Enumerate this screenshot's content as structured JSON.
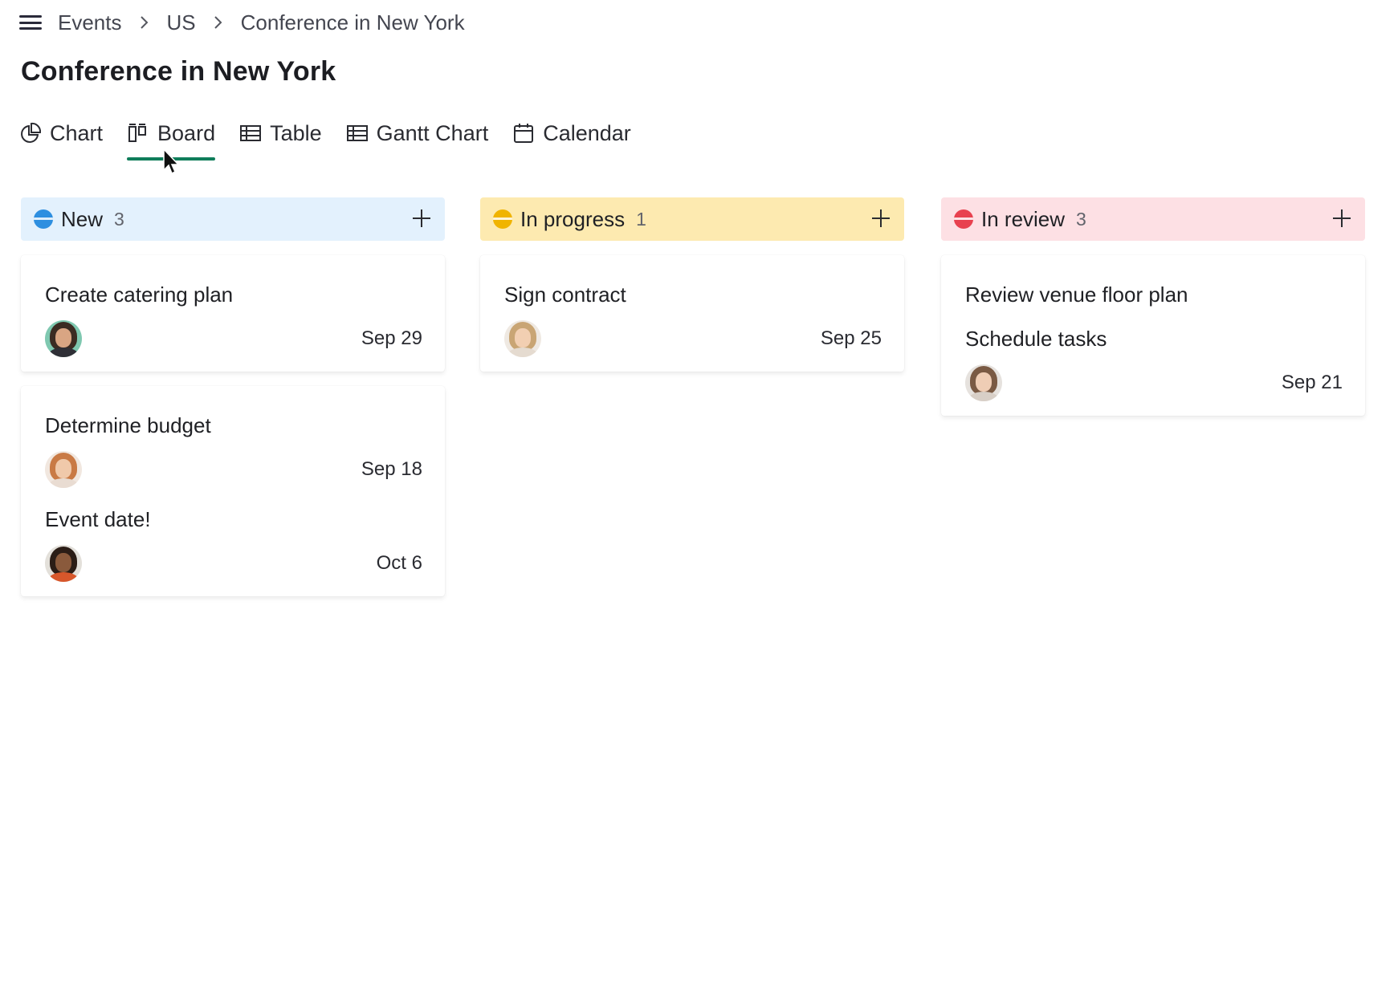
{
  "breadcrumb": {
    "items": [
      "Events",
      "US",
      "Conference in New York"
    ]
  },
  "page_title": "Conference in New York",
  "tabs": [
    {
      "label": "Chart",
      "icon": "pie-chart-icon",
      "active": false
    },
    {
      "label": "Board",
      "icon": "board-icon",
      "active": true
    },
    {
      "label": "Table",
      "icon": "table-icon",
      "active": false
    },
    {
      "label": "Gantt Chart",
      "icon": "gantt-icon",
      "active": false
    },
    {
      "label": "Calendar",
      "icon": "calendar-icon",
      "active": false
    }
  ],
  "accent_color": "#0f7d5a",
  "columns": [
    {
      "title": "New",
      "count": "3",
      "status_color": "#2e8fe0",
      "header_bg": "#e3f1fd",
      "cards": [
        {
          "tasks": [
            {
              "title": "Create catering plan",
              "due": "Sep 29",
              "avatar": "avatar-man-beard"
            }
          ]
        },
        {
          "tasks": [
            {
              "title": "Determine budget",
              "due": "Sep 18",
              "avatar": "avatar-woman-red-hair"
            },
            {
              "title": "Event date!",
              "due": "Oct 6",
              "avatar": "avatar-man-glasses"
            }
          ]
        }
      ]
    },
    {
      "title": "In progress",
      "count": "1",
      "status_color": "#f0b400",
      "header_bg": "#fdeab0",
      "cards": [
        {
          "tasks": [
            {
              "title": "Sign contract",
              "due": "Sep 25",
              "avatar": "avatar-woman-blonde"
            }
          ]
        }
      ]
    },
    {
      "title": "In review",
      "count": "3",
      "status_color": "#e8414f",
      "header_bg": "#fde0e4",
      "cards": [
        {
          "tasks": [
            {
              "title": "Review venue floor plan",
              "due": null,
              "avatar": null
            },
            {
              "title": "Schedule tasks",
              "due": "Sep 21",
              "avatar": "avatar-woman-brown-hair"
            }
          ]
        }
      ]
    }
  ]
}
